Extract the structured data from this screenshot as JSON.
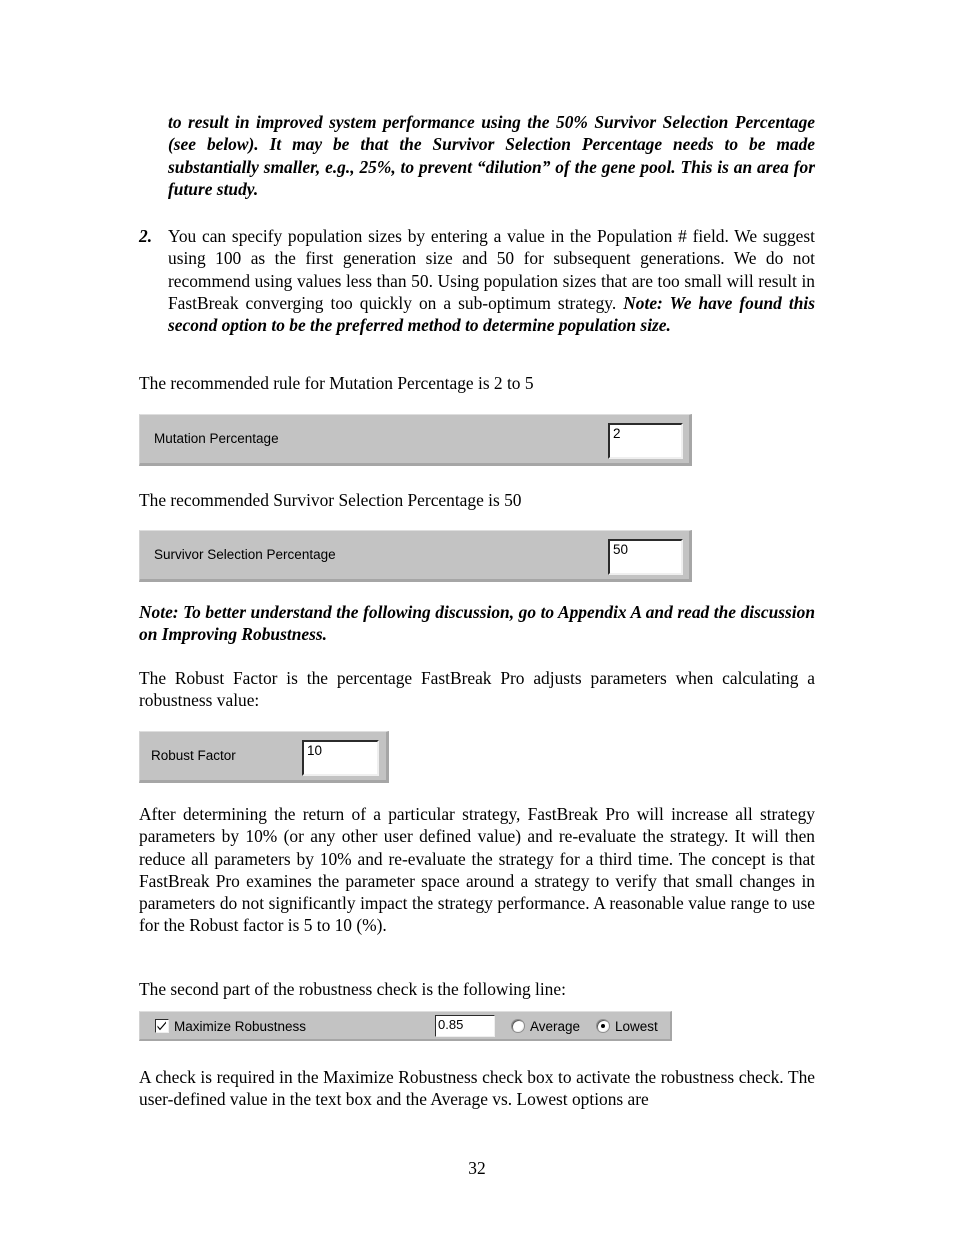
{
  "document": {
    "page_number": "32",
    "paragraphs": {
      "intro_note": "to result in improved system performance using the 50% Survivor Selection Percentage (see below).  It may be that the Survivor Selection Percentage needs to be made substantially smaller, e.g., 25%, to prevent “dilution” of the gene pool. This is an area for future study.",
      "list_item_2_marker": "2.",
      "list_item_2_text": "You can specify population sizes by entering a value in the Population # field.  We suggest using 100 as the first generation size and 50 for subsequent generations.  We do not recommend using values less than 50.   Using population sizes that are too small will result in FastBreak converging too quickly on a sub-optimum strategy.  ",
      "list_item_2_note": "Note:  We have found this second option to be the preferred method to determine population size.",
      "rule_mutation": "The recommended rule for Mutation Percentage is 2 to 5",
      "rule_survivor": "The recommended Survivor Selection Percentage is 50",
      "note_appendix": "Note: To better understand the following discussion, go to Appendix A and read the discussion on Improving Robustness.",
      "robust_intro": "The Robust Factor is the percentage FastBreak Pro adjusts parameters when calculating a robustness value:",
      "after_determining": "After determining the return of a particular strategy, FastBreak Pro will increase all strategy parameters by 10% (or any other user defined value) and re-evaluate the strategy.  It will then reduce all parameters by 10% and re-evaluate the strategy for a third time.  The concept is that FastBreak Pro examines the parameter space around a strategy to verify that small changes in parameters do not significantly impact the strategy performance.  A reasonable value range to use for the Robust factor is 5 to 10 (%).",
      "second_part": "The second part of the robustness check is the following line:",
      "check_required": "A check is required in the Maximize Robustness check box to activate the robustness check.  The user-defined value in the text box and the Average vs. Lowest options are"
    }
  },
  "widgets": {
    "mutation": {
      "label": "Mutation Percentage",
      "value": "2"
    },
    "survivor": {
      "label": "Survivor Selection Percentage",
      "value": "50"
    },
    "robust_factor": {
      "label": "Robust Factor",
      "value": "10"
    },
    "maximize_robustness": {
      "checkbox_label": "Maximize Robustness",
      "checkbox_checked": "true",
      "value": "0.85",
      "radio_average_label": "Average",
      "radio_lowest_label": "Lowest",
      "radio_selected": "Lowest"
    }
  },
  "colors": {
    "panel_face": "#c3c3c3",
    "panel_shadow": "#a6a6a6",
    "panel_highlight": "#dedede",
    "textbox_face": "#ffffff",
    "text": "#000000"
  }
}
